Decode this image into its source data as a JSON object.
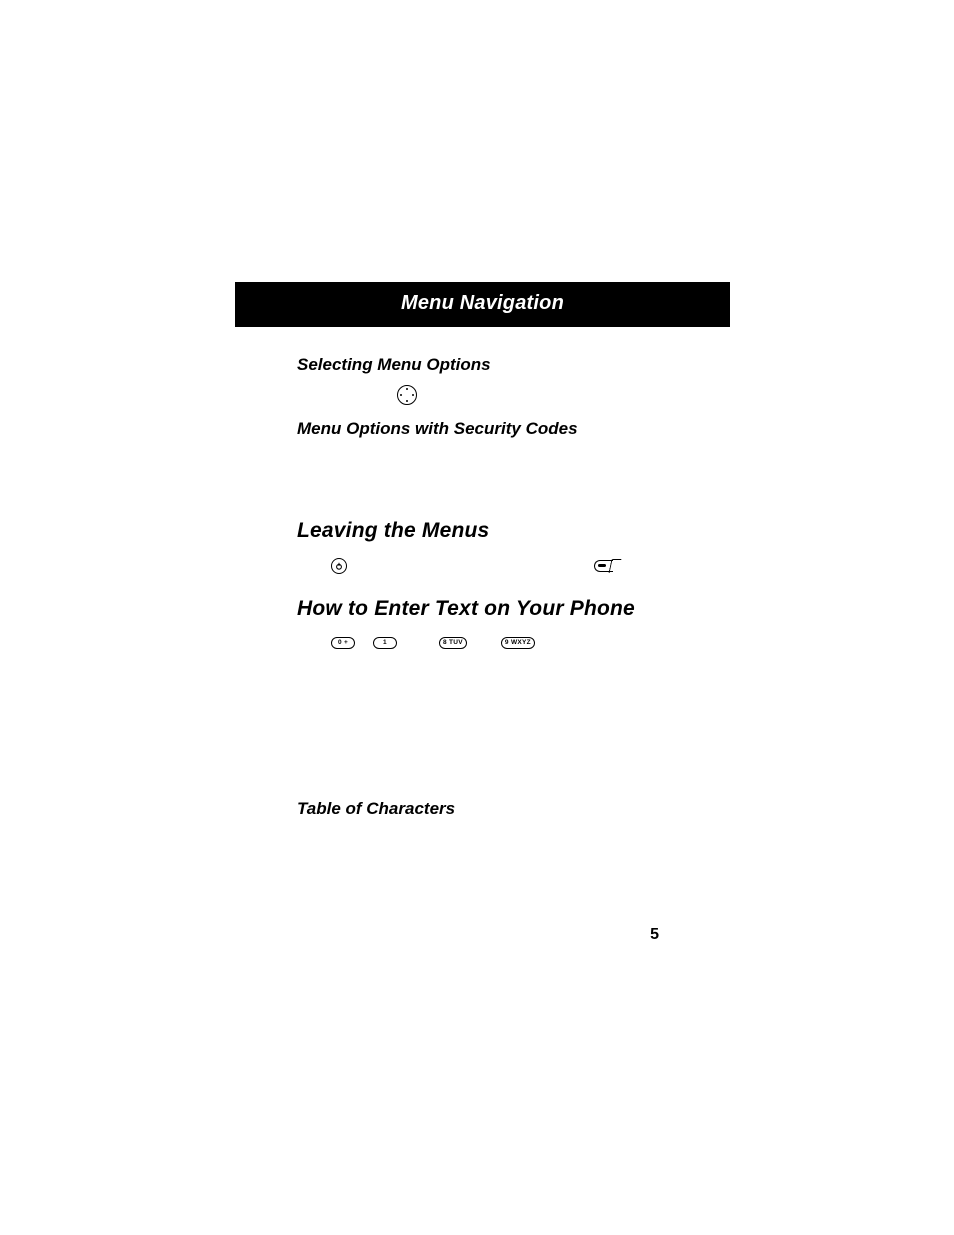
{
  "banner_title": "Menu Navigation",
  "sections": {
    "selecting": "Selecting Menu Options",
    "security": "Menu Options with Security Codes",
    "leaving": "Leaving the Menus",
    "enter_text": "How to Enter Text on Your Phone",
    "table_chars": "Table of Characters"
  },
  "keys": {
    "k0": "0 +",
    "k1": "1 ",
    "k8": "8 TUV",
    "k9": "9 WXYZ"
  },
  "page_number": "5"
}
